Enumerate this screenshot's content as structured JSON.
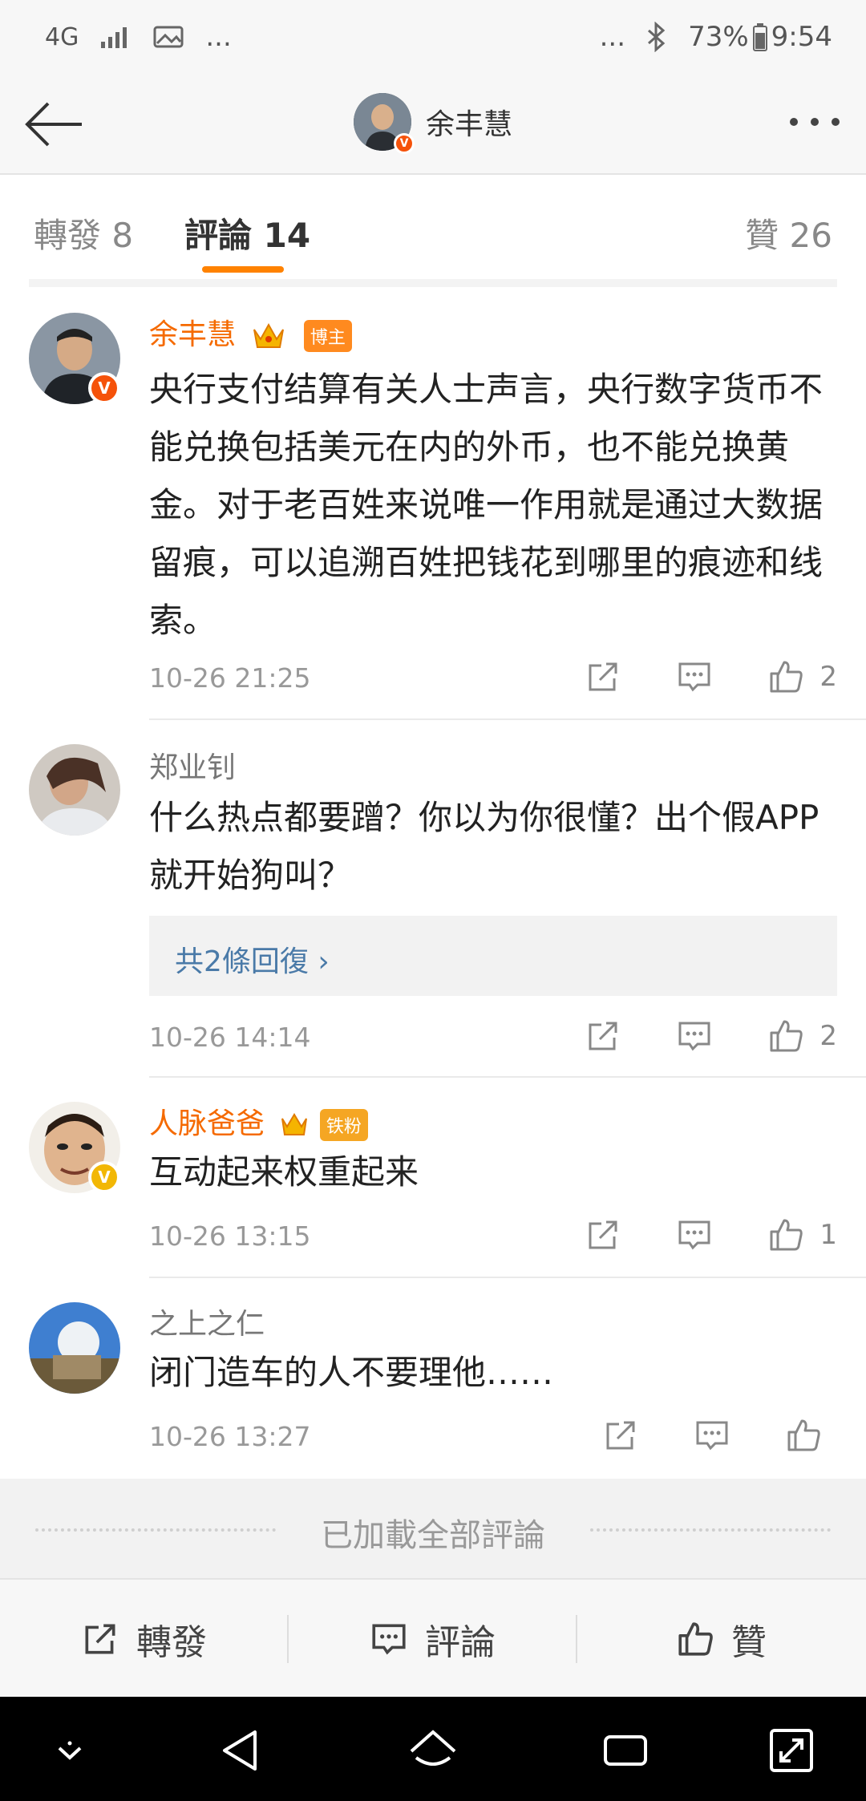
{
  "status": {
    "network": "4G",
    "more": "...",
    "battery_percent": "73%",
    "time": "9:54"
  },
  "header": {
    "title": "余丰慧"
  },
  "tabs": [
    {
      "label": "轉發 8"
    },
    {
      "label": "評論 14",
      "active": true
    },
    {
      "label": "贊 26"
    }
  ],
  "comments": [
    {
      "name": "余丰慧",
      "badge": "博主",
      "verified": "V",
      "text": " 央行支付结算有关人士声言，央行数字货币不能兑换包括美元在内的外币，也不能兑换黄金。对于老百姓来说唯一作用就是通过大数据留痕，可以追溯百姓把钱花到哪里的痕迹和线索。",
      "time": "10-26 21:25",
      "likes": "2"
    },
    {
      "name": "郑业钊",
      "text": "什么热点都要蹭？你以为你很懂？出个假APP就开始狗叫？",
      "replies": "共2條回復 ›",
      "time": "10-26 14:14",
      "likes": "2"
    },
    {
      "name": "人脉爸爸",
      "badge": "铁粉",
      "verified": "V",
      "text": "互动起来权重起来",
      "time": "10-26 13:15",
      "likes": "1"
    },
    {
      "name": "之上之仁",
      "text": "闭门造车的人不要理他……",
      "time": "10-26 13:27",
      "likes": ""
    }
  ],
  "loaded_text": "已加載全部評論",
  "action_bar": {
    "repost": "轉發",
    "comment": "評論",
    "like": "贊"
  },
  "colors": {
    "accent": "#ff8200",
    "name_orange": "#f56a00",
    "link_blue": "#4a7aa8"
  }
}
